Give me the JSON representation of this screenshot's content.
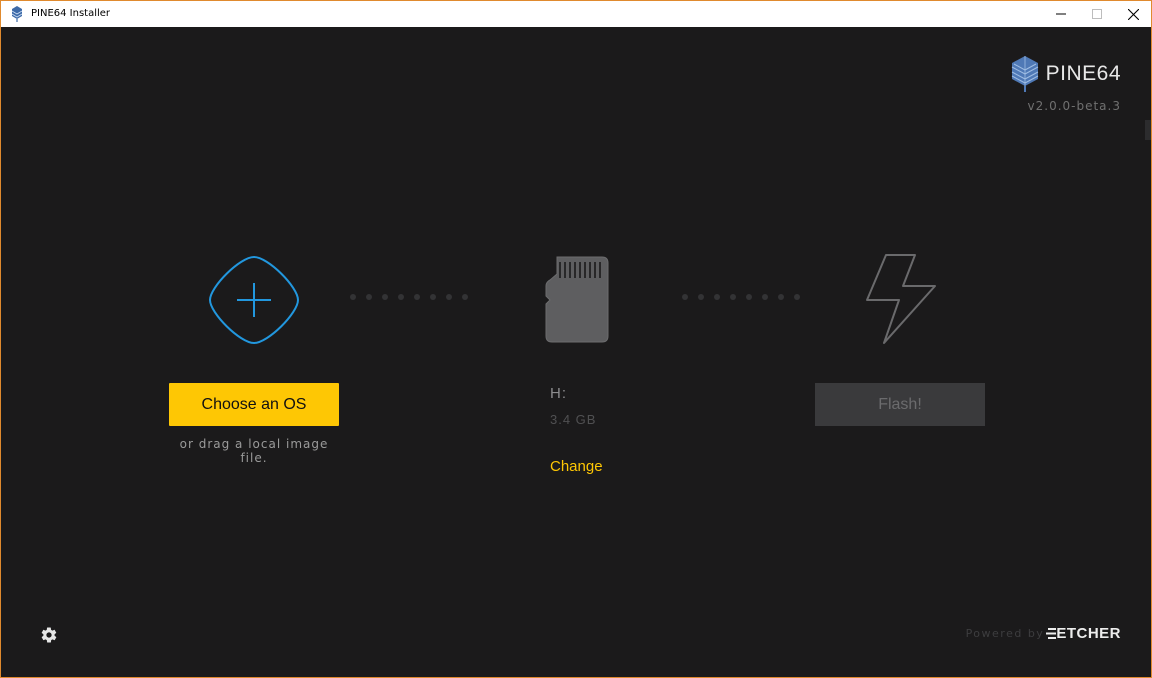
{
  "window": {
    "title": "PINE64 Installer"
  },
  "brand": {
    "name": "PINE64",
    "version": "v2.0.0-beta.3",
    "accent_color": "#4f79b6"
  },
  "steps": {
    "image": {
      "button_label": "Choose an OS",
      "hint": "or drag a local image file.",
      "icon": "add-image-icon",
      "color": "#2297de"
    },
    "drive": {
      "name": "H:",
      "size": "3.4 GB",
      "change_label": "Change",
      "icon": "sd-card-icon"
    },
    "flash": {
      "button_label": "Flash!",
      "icon": "lightning-icon",
      "enabled": false
    }
  },
  "footer": {
    "powered_by": "Powered by",
    "etcher": "ETCHER",
    "settings_icon": "gear-icon"
  },
  "colors": {
    "background": "#1b1a1b",
    "primary_button": "#fec704",
    "disabled_button": "#3a3a3c",
    "link": "#fec704"
  }
}
